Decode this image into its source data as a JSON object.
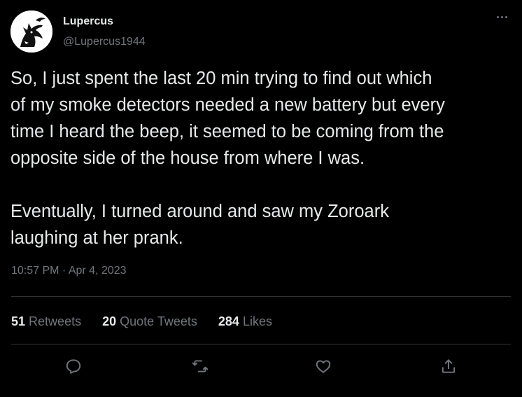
{
  "author": {
    "name": "Lupercus",
    "handle": "@Lupercus1944",
    "avatar_icon": "wolf-avatar-icon"
  },
  "tweet": {
    "text": "So, I just spent the last 20 min trying to find out which\nof my smoke detectors needed a new battery but every\ntime I heard the beep, it seemed to be coming from the\nopposite side of the house from where I was.\n\nEventually, I turned around and saw my Zoroark\nlaughing at her prank.",
    "timestamp": "10:57 PM · Apr 4, 2023"
  },
  "stats": {
    "retweets_count": "51",
    "retweets_label": "Retweets",
    "quotes_count": "20",
    "quotes_label": "Quote Tweets",
    "likes_count": "284",
    "likes_label": "Likes"
  },
  "actions": {
    "reply_icon": "reply-icon",
    "retweet_icon": "retweet-icon",
    "like_icon": "heart-icon",
    "share_icon": "share-icon"
  },
  "colors": {
    "background": "#000000",
    "text": "#e7e9ea",
    "muted": "#71767b",
    "divider": "#2f3336"
  }
}
